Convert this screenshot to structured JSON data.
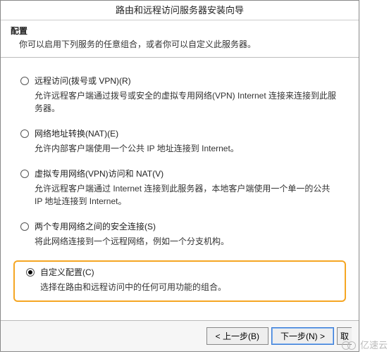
{
  "title": "路由和远程访问服务器安装向导",
  "header": {
    "label": "配置",
    "desc": "你可以启用下列服务的任意组合，或者你可以自定义此服务器。"
  },
  "options": [
    {
      "label": "远程访问(拨号或 VPN)(R)",
      "desc": "允许远程客户端通过拨号或安全的虚拟专用网络(VPN) Internet 连接来连接到此服务器。",
      "selected": false
    },
    {
      "label": "网络地址转换(NAT)(E)",
      "desc": "允许内部客户端使用一个公共 IP 地址连接到 Internet。",
      "selected": false
    },
    {
      "label": "虚拟专用网络(VPN)访问和 NAT(V)",
      "desc": "允许远程客户端通过 Internet 连接到此服务器，本地客户端使用一个单一的公共 IP 地址连接到 Internet。",
      "selected": false
    },
    {
      "label": "两个专用网络之间的安全连接(S)",
      "desc": "将此网络连接到一个远程网络，例如一个分支机构。",
      "selected": false
    },
    {
      "label": "自定义配置(C)",
      "desc": "选择在路由和远程访问中的任何可用功能的组合。",
      "selected": true
    }
  ],
  "footer": {
    "back": "< 上一步(B)",
    "next": "下一步(N) >",
    "cancel_fragment": "取"
  },
  "watermark": "亿速云"
}
